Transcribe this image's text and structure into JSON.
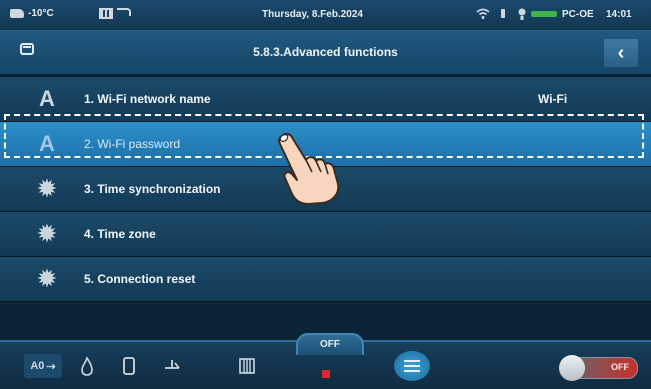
{
  "status_bar": {
    "temperature": "-10°C",
    "date": "Thursday, 8.Feb.2024",
    "device": "PC-OE",
    "time": "14:01",
    "battery_fill": 1.0
  },
  "header": {
    "title": "5.8.3.Advanced functions",
    "back_symbol": "‹"
  },
  "list": {
    "items": [
      {
        "icon": "letter-a-icon",
        "glyph": "A",
        "label": "1. Wi-Fi network name",
        "value": "Wi-Fi"
      },
      {
        "icon": "letter-a-icon",
        "glyph": "A",
        "label": "2. Wi-Fi password",
        "value": ""
      },
      {
        "icon": "gear-icon",
        "glyph": "✹",
        "label": "3. Time synchronization",
        "value": ""
      },
      {
        "icon": "gear-icon",
        "glyph": "✹",
        "label": "4. Time zone",
        "value": ""
      },
      {
        "icon": "gear-icon",
        "glyph": "✹",
        "label": "5. Connection reset",
        "value": ""
      }
    ]
  },
  "bottom_bar": {
    "off_label": "OFF",
    "auto_label": "A0",
    "toggle_label": "OFF"
  },
  "colors": {
    "accent_active_row": "#2c8fc9",
    "stop_red": "#e0282a",
    "battery_green": "#3fb34a"
  }
}
